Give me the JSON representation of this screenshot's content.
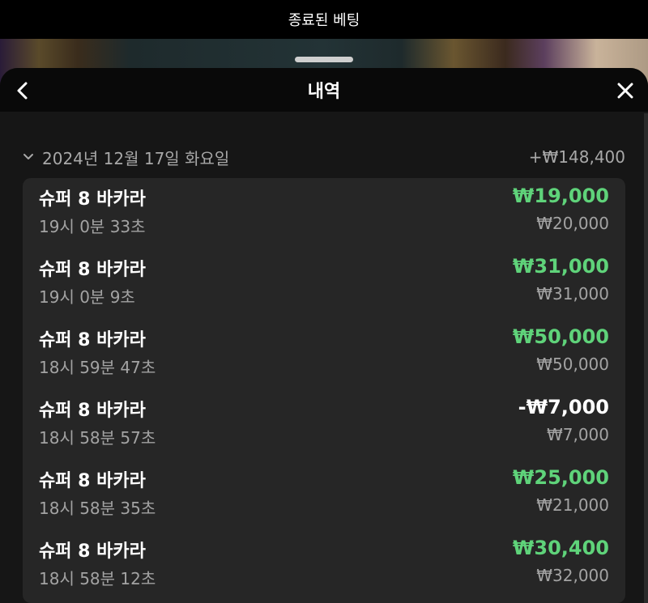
{
  "topbar": {
    "title": "종료된 베팅"
  },
  "sheet": {
    "title": "내역"
  },
  "icons": {
    "back": "chevron-left-icon",
    "close": "close-icon",
    "expand": "chevron-down-icon"
  },
  "colors": {
    "win": "#5fd37a",
    "loss": "#ffffff"
  },
  "date_group": {
    "label": "2024년 12월 17일 화요일",
    "total": "+₩148,400"
  },
  "entries": [
    {
      "game": "슈퍼 8 바카라",
      "time": "19시 0분 33초",
      "result": "₩19,000",
      "stake": "₩20,000",
      "outcome": "win"
    },
    {
      "game": "슈퍼 8 바카라",
      "time": "19시 0분 9초",
      "result": "₩31,000",
      "stake": "₩31,000",
      "outcome": "win"
    },
    {
      "game": "슈퍼 8 바카라",
      "time": "18시 59분 47초",
      "result": "₩50,000",
      "stake": "₩50,000",
      "outcome": "win"
    },
    {
      "game": "슈퍼 8 바카라",
      "time": "18시 58분 57초",
      "result": "-₩7,000",
      "stake": "₩7,000",
      "outcome": "loss"
    },
    {
      "game": "슈퍼 8 바카라",
      "time": "18시 58분 35초",
      "result": "₩25,000",
      "stake": "₩21,000",
      "outcome": "win"
    },
    {
      "game": "슈퍼 8 바카라",
      "time": "18시 58분 12초",
      "result": "₩30,400",
      "stake": "₩32,000",
      "outcome": "win"
    }
  ]
}
